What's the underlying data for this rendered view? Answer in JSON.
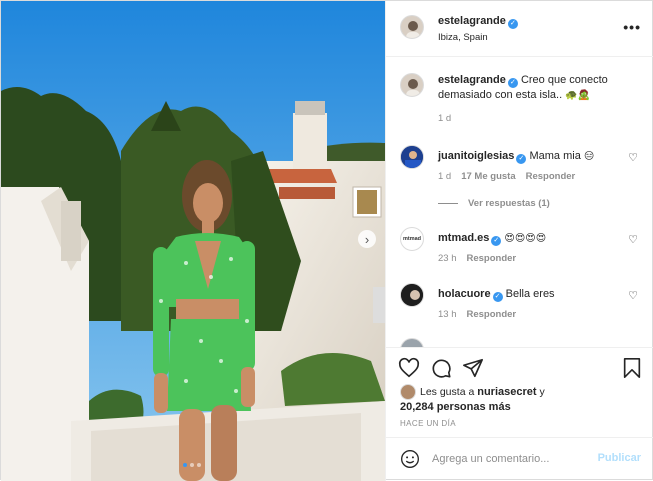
{
  "post": {
    "author": "estelagrande",
    "location": "Ibiza, Spain"
  },
  "caption": {
    "username": "estelagrande",
    "text": "Creo que conecto demasiado con esta isla..",
    "emojis": "🐢🧟",
    "age": "1 d"
  },
  "comments": [
    {
      "username": "juanitoiglesias",
      "text": "Mama mia",
      "emoji": "😑",
      "age": "1 d",
      "likes": "17 Me gusta",
      "reply_label": "Responder",
      "view_replies": "Ver respuestas (1)"
    },
    {
      "username": "mtmad.es",
      "avatar_text": "mtmad",
      "text": "",
      "emoji": "😍😍😍😍",
      "age": "23 h",
      "reply_label": "Responder"
    },
    {
      "username": "holacuore",
      "text": "Bella eres",
      "age": "13 h",
      "reply_label": "Responder"
    }
  ],
  "likes": {
    "line1_prefix": "Les gusta a",
    "liker": "nuriasecret",
    "line1_suffix": "y",
    "line2": "20,284 personas más"
  },
  "timestamp": "HACE UN DÍA",
  "comment_box": {
    "placeholder": "Agrega un comentario...",
    "publish_label": "Publicar"
  },
  "colors": {
    "verified": "#3897f0",
    "publish_disabled": "#b2dffc",
    "sky": "#2e8fe0"
  },
  "icons": [
    "more-icon",
    "heart-icon",
    "comment-icon",
    "share-icon",
    "bookmark-icon",
    "smile-icon",
    "next-arrow-icon",
    "verified-icon"
  ]
}
